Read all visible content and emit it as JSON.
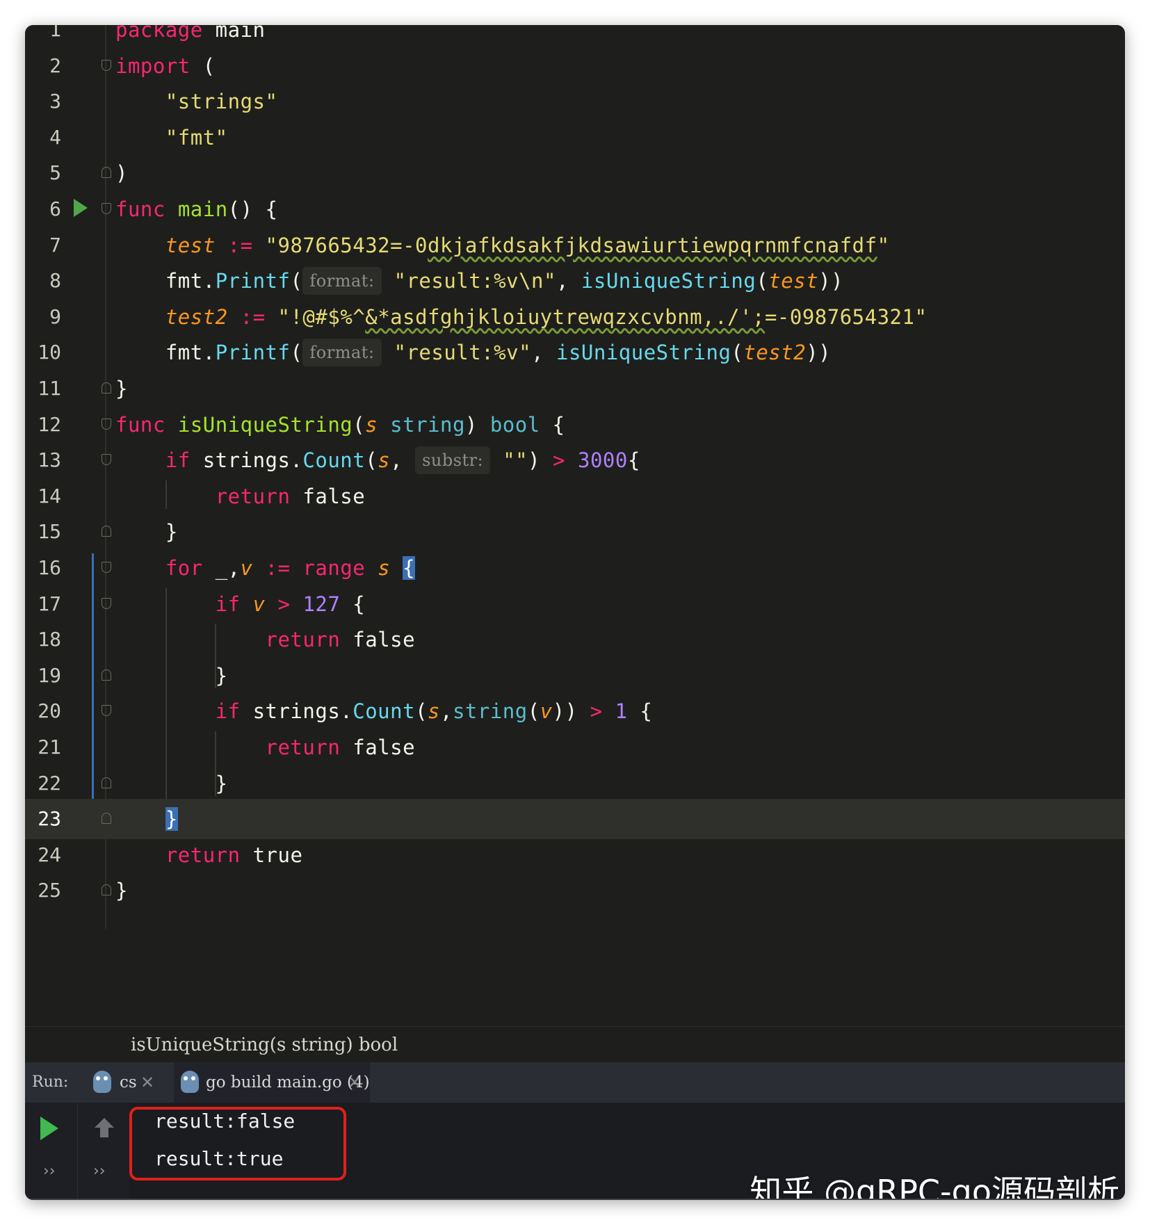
{
  "editor": {
    "lines": [
      {
        "num": "1",
        "segments": [
          {
            "t": "package",
            "c": "kw"
          },
          {
            "t": " main",
            "c": ""
          }
        ]
      },
      {
        "num": "2",
        "segments": [
          {
            "t": "import",
            "c": "kw"
          },
          {
            "t": " (",
            "c": ""
          }
        ]
      },
      {
        "num": "3",
        "segments": [
          {
            "t": "    ",
            "c": ""
          },
          {
            "t": "\"strings\"",
            "c": "str"
          }
        ]
      },
      {
        "num": "4",
        "segments": [
          {
            "t": "    ",
            "c": ""
          },
          {
            "t": "\"fmt\"",
            "c": "str"
          }
        ]
      },
      {
        "num": "5",
        "segments": [
          {
            "t": ")",
            "c": ""
          }
        ]
      },
      {
        "num": "6",
        "segments": [
          {
            "t": "func",
            "c": "kw"
          },
          {
            "t": " ",
            "c": ""
          },
          {
            "t": "main",
            "c": "fn"
          },
          {
            "t": "() {",
            "c": ""
          }
        ]
      },
      {
        "num": "7",
        "segments": [
          {
            "t": "    ",
            "c": ""
          },
          {
            "t": "test",
            "c": "it"
          },
          {
            "t": " ",
            "c": ""
          },
          {
            "t": ":=",
            "c": "kw"
          },
          {
            "t": " ",
            "c": ""
          },
          {
            "t": "\"987665432=-0",
            "c": "str"
          },
          {
            "t": "dkjafkdsakfjkdsawiurtiewpqrnmfcnafdf",
            "c": "str wavy"
          },
          {
            "t": "\"",
            "c": "str"
          }
        ]
      },
      {
        "num": "8",
        "segments": [
          {
            "t": "    fmt.",
            "c": ""
          },
          {
            "t": "Printf",
            "c": "call"
          },
          {
            "t": "(",
            "c": ""
          },
          {
            "t": "format:",
            "c": "hint"
          },
          {
            "t": " ",
            "c": ""
          },
          {
            "t": "\"result:%v\\n\"",
            "c": "str"
          },
          {
            "t": ", ",
            "c": ""
          },
          {
            "t": "isUniqueString",
            "c": "call"
          },
          {
            "t": "(",
            "c": ""
          },
          {
            "t": "test",
            "c": "it"
          },
          {
            "t": "))",
            "c": ""
          }
        ]
      },
      {
        "num": "9",
        "segments": [
          {
            "t": "    ",
            "c": ""
          },
          {
            "t": "test2",
            "c": "it"
          },
          {
            "t": " ",
            "c": ""
          },
          {
            "t": ":=",
            "c": "kw"
          },
          {
            "t": " ",
            "c": ""
          },
          {
            "t": "\"!@#$%^",
            "c": "str"
          },
          {
            "t": "&*asdfghjkloiuytrewqzxcvbnm,./';",
            "c": "str wavy"
          },
          {
            "t": "=-0987654321\"",
            "c": "str"
          }
        ]
      },
      {
        "num": "10",
        "segments": [
          {
            "t": "    fmt.",
            "c": ""
          },
          {
            "t": "Printf",
            "c": "call"
          },
          {
            "t": "(",
            "c": ""
          },
          {
            "t": "format:",
            "c": "hint"
          },
          {
            "t": " ",
            "c": ""
          },
          {
            "t": "\"result:%v\"",
            "c": "str"
          },
          {
            "t": ", ",
            "c": ""
          },
          {
            "t": "isUniqueString",
            "c": "call"
          },
          {
            "t": "(",
            "c": ""
          },
          {
            "t": "test2",
            "c": "it"
          },
          {
            "t": "))",
            "c": ""
          }
        ]
      },
      {
        "num": "11",
        "segments": [
          {
            "t": "}",
            "c": ""
          }
        ]
      },
      {
        "num": "12",
        "segments": [
          {
            "t": "func",
            "c": "kw"
          },
          {
            "t": " ",
            "c": ""
          },
          {
            "t": "isUniqueString",
            "c": "fn"
          },
          {
            "t": "(",
            "c": ""
          },
          {
            "t": "s",
            "c": "it"
          },
          {
            "t": " ",
            "c": ""
          },
          {
            "t": "string",
            "c": "type"
          },
          {
            "t": ") ",
            "c": ""
          },
          {
            "t": "bool",
            "c": "type"
          },
          {
            "t": " {",
            "c": ""
          }
        ]
      },
      {
        "num": "13",
        "segments": [
          {
            "t": "    ",
            "c": ""
          },
          {
            "t": "if",
            "c": "kw"
          },
          {
            "t": " strings.",
            "c": ""
          },
          {
            "t": "Count",
            "c": "call"
          },
          {
            "t": "(",
            "c": ""
          },
          {
            "t": "s",
            "c": "it"
          },
          {
            "t": ", ",
            "c": ""
          },
          {
            "t": "substr:",
            "c": "hint"
          },
          {
            "t": " ",
            "c": ""
          },
          {
            "t": "\"\"",
            "c": "str"
          },
          {
            "t": ") ",
            "c": ""
          },
          {
            "t": ">",
            "c": "kw"
          },
          {
            "t": " ",
            "c": ""
          },
          {
            "t": "3000",
            "c": "num"
          },
          {
            "t": "{",
            "c": ""
          }
        ]
      },
      {
        "num": "14",
        "segments": [
          {
            "t": "        ",
            "c": ""
          },
          {
            "t": "return",
            "c": "kw"
          },
          {
            "t": " false",
            "c": ""
          }
        ]
      },
      {
        "num": "15",
        "segments": [
          {
            "t": "    }",
            "c": ""
          }
        ]
      },
      {
        "num": "16",
        "segments": [
          {
            "t": "    ",
            "c": ""
          },
          {
            "t": "for",
            "c": "kw"
          },
          {
            "t": " _,",
            "c": ""
          },
          {
            "t": "v",
            "c": "it"
          },
          {
            "t": " ",
            "c": ""
          },
          {
            "t": ":=",
            "c": "kw"
          },
          {
            "t": " ",
            "c": ""
          },
          {
            "t": "range",
            "c": "kw"
          },
          {
            "t": " ",
            "c": ""
          },
          {
            "t": "s",
            "c": "it"
          },
          {
            "t": " ",
            "c": ""
          },
          {
            "t": "{",
            "c": "bracehl"
          }
        ]
      },
      {
        "num": "17",
        "segments": [
          {
            "t": "        ",
            "c": ""
          },
          {
            "t": "if",
            "c": "kw"
          },
          {
            "t": " ",
            "c": ""
          },
          {
            "t": "v",
            "c": "it"
          },
          {
            "t": " ",
            "c": ""
          },
          {
            "t": ">",
            "c": "kw"
          },
          {
            "t": " ",
            "c": ""
          },
          {
            "t": "127",
            "c": "num"
          },
          {
            "t": " {",
            "c": ""
          }
        ]
      },
      {
        "num": "18",
        "segments": [
          {
            "t": "            ",
            "c": ""
          },
          {
            "t": "return",
            "c": "kw"
          },
          {
            "t": " false",
            "c": ""
          }
        ]
      },
      {
        "num": "19",
        "segments": [
          {
            "t": "        }",
            "c": ""
          }
        ]
      },
      {
        "num": "20",
        "segments": [
          {
            "t": "        ",
            "c": ""
          },
          {
            "t": "if",
            "c": "kw"
          },
          {
            "t": " strings.",
            "c": ""
          },
          {
            "t": "Count",
            "c": "call"
          },
          {
            "t": "(",
            "c": ""
          },
          {
            "t": "s",
            "c": "it"
          },
          {
            "t": ",",
            "c": ""
          },
          {
            "t": "string",
            "c": "type"
          },
          {
            "t": "(",
            "c": ""
          },
          {
            "t": "v",
            "c": "it"
          },
          {
            "t": ")) ",
            "c": ""
          },
          {
            "t": ">",
            "c": "kw"
          },
          {
            "t": " ",
            "c": ""
          },
          {
            "t": "1",
            "c": "num"
          },
          {
            "t": " {",
            "c": ""
          }
        ]
      },
      {
        "num": "21",
        "segments": [
          {
            "t": "            ",
            "c": ""
          },
          {
            "t": "return",
            "c": "kw"
          },
          {
            "t": " false",
            "c": ""
          }
        ]
      },
      {
        "num": "22",
        "segments": [
          {
            "t": "        }",
            "c": ""
          }
        ]
      },
      {
        "num": "23",
        "segments": [
          {
            "t": "    ",
            "c": ""
          },
          {
            "t": "}",
            "c": "bracehl"
          }
        ]
      },
      {
        "num": "24",
        "segments": [
          {
            "t": "    ",
            "c": ""
          },
          {
            "t": "return",
            "c": "kw"
          },
          {
            "t": " true",
            "c": ""
          }
        ]
      },
      {
        "num": "25",
        "segments": [
          {
            "t": "}",
            "c": ""
          }
        ]
      }
    ]
  },
  "statusbar": {
    "signature": "isUniqueString(s string) bool"
  },
  "run": {
    "label": "Run:",
    "tabs": [
      {
        "label": "cs"
      },
      {
        "label": "go build main.go (4)"
      }
    ],
    "output": [
      "result:false",
      "result:true"
    ]
  },
  "watermark": "知乎 @gRPC-go源码剖析",
  "colors": {
    "keyword": "#f92672",
    "function": "#a6e22e",
    "string": "#e6db74",
    "number": "#ae81ff",
    "param": "#fd971f",
    "call": "#66d9ef",
    "highlight_box": "#e0201b",
    "run_icon": "#3fb950"
  }
}
